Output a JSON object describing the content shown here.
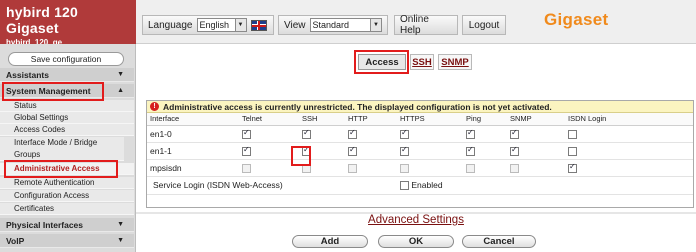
{
  "brand": {
    "title": "hybird 120 Gigaset",
    "subtitle": "hybird_120_ge"
  },
  "topbar": {
    "language_label": "Language",
    "language_value": "English",
    "view_label": "View",
    "view_value": "Standard",
    "online_help": "Online Help",
    "logout": "Logout",
    "logo": "Gigaset"
  },
  "sidebar": {
    "save": "Save configuration",
    "sections": [
      "Assistants",
      "System Management",
      "Physical Interfaces",
      "VoIP"
    ],
    "items": [
      "Status",
      "Global Settings",
      "Access Codes",
      "Interface Mode / Bridge Groups",
      "Administrative Access",
      "Remote Authentication",
      "Configuration Access",
      "Certificates"
    ]
  },
  "tabs": [
    "Access",
    "SSH",
    "SNMP"
  ],
  "main": {
    "warning": "Administrative access is currently unrestricted. The displayed configuration is not yet activated.",
    "columns": [
      "Interface",
      "Telnet",
      "SSH",
      "HTTP",
      "HTTPS",
      "Ping",
      "SNMP",
      "ISDN Login"
    ],
    "rows": [
      {
        "name": "en1-0",
        "checks": [
          true,
          true,
          true,
          true,
          true,
          true,
          false
        ]
      },
      {
        "name": "en1-1",
        "checks": [
          true,
          true,
          true,
          true,
          true,
          true,
          false
        ]
      },
      {
        "name": "mpsisdn",
        "checks": [
          false,
          false,
          false,
          false,
          false,
          false,
          true
        ]
      }
    ],
    "service_login_label": "Service Login (ISDN Web-Access)",
    "enabled_label": "Enabled",
    "advanced": "Advanced Settings",
    "buttons": {
      "add": "Add",
      "ok": "OK",
      "cancel": "Cancel"
    }
  }
}
